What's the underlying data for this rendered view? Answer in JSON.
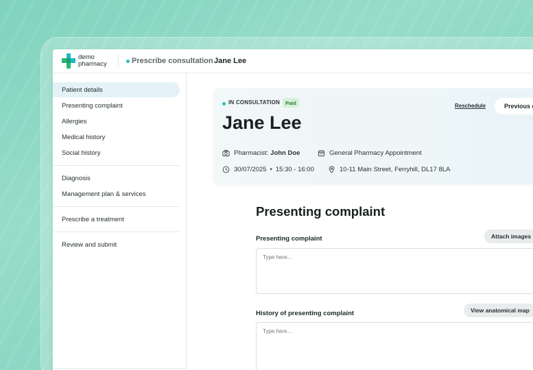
{
  "header": {
    "logo_line1": "demo",
    "logo_line2": "pharmacy",
    "section": "Prescribe consultation",
    "patient": "Jane Lee"
  },
  "sidebar": {
    "group1": [
      "Patient details",
      "Presenting complaint",
      "Allergies",
      "Medical history",
      "Social history"
    ],
    "group2": [
      "Diagnosis",
      "Management plan & services"
    ],
    "group3": [
      "Prescribe a treatment"
    ],
    "group4": [
      "Review and submit"
    ]
  },
  "card": {
    "status": "IN CONSULTATION",
    "badge": "Paid",
    "reschedule": "Reschedule",
    "previous": "Previous c",
    "name": "Jane Lee",
    "pharmacist_label": "Pharmacist:",
    "pharmacist_name": "John Doe",
    "appointment_type": "General Pharmacy Appointment",
    "date": "30/07/2025",
    "separator": "•",
    "time": "15:30 - 16:00",
    "address": "10-11 Main Street, Ferryhill, DL17 8LA"
  },
  "form": {
    "title": "Presenting complaint",
    "field1_label": "Presenting complaint",
    "field1_button": "Attach images",
    "field1_placeholder": "Type here...",
    "field2_label": "History of presenting complaint",
    "field2_button": "View anatomical map",
    "field2_placeholder": "Type here..."
  },
  "colors": {
    "accent": "#1fc2c6",
    "logo_green": "#2bb673",
    "logo_teal": "#1fb7c9",
    "active_bg": "#e4f2f7",
    "paid_bg": "#d7f1d9"
  }
}
